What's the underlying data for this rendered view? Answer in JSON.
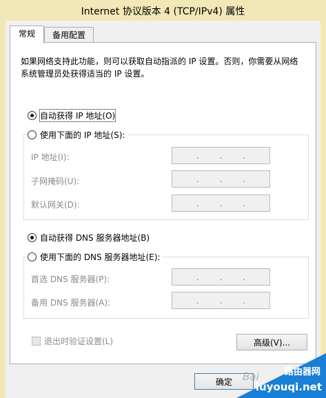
{
  "window": {
    "title": "Internet 协议版本 4 (TCP/IPv4) 属性"
  },
  "tabs": [
    {
      "label": "常规",
      "active": true
    },
    {
      "label": "备用配置",
      "active": false
    }
  ],
  "description": "如果网络支持此功能，则可以获取自动指派的 IP 设置。否则，你需要从网络系统管理员处获得适当的 IP 设置。",
  "ip_section": {
    "auto_radio": {
      "label": "自动获得 IP 地址(O)",
      "selected": true
    },
    "manual_radio": {
      "label": "使用下面的 IP 地址(S):",
      "selected": false
    },
    "fields": [
      {
        "label": "IP 地址(I):",
        "value": ". . ."
      },
      {
        "label": "子网掩码(U):",
        "value": ". . ."
      },
      {
        "label": "默认网关(D):",
        "value": ". . ."
      }
    ]
  },
  "dns_section": {
    "auto_radio": {
      "label": "自动获得 DNS 服务器地址(B)",
      "selected": true
    },
    "manual_radio": {
      "label": "使用下面的 DNS 服务器地址(E):",
      "selected": false
    },
    "fields": [
      {
        "label": "首选 DNS 服务器(P):",
        "value": ". . ."
      },
      {
        "label": "备用 DNS 服务器(A):",
        "value": ". . ."
      }
    ]
  },
  "validate_checkbox": {
    "label": "退出时验证设置(L)",
    "checked": false,
    "enabled": false
  },
  "buttons": {
    "advanced": "高级(V)...",
    "ok": "确定"
  },
  "watermark": {
    "brand": "路由器网",
    "url": "luyouqi.net",
    "baidu": "Bai"
  },
  "colors": {
    "titlebar": "#f2e8b7",
    "watermark": "#1a7fd6"
  }
}
